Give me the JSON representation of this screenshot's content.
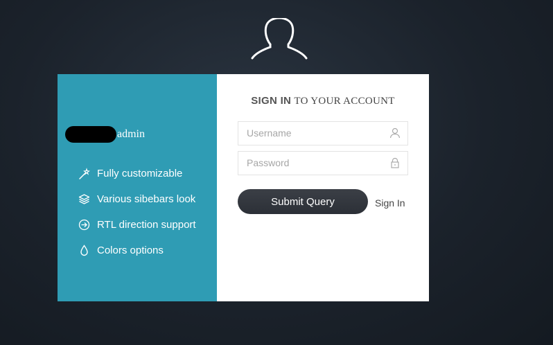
{
  "header": {
    "icon": "user-icon"
  },
  "brand": {
    "text": "admin"
  },
  "features": [
    {
      "icon": "magic-wand-icon",
      "label": "Fully customizable"
    },
    {
      "icon": "layers-icon",
      "label": "Various sibebars look"
    },
    {
      "icon": "circle-arrow-right-icon",
      "label": "RTL direction support"
    },
    {
      "icon": "drop-icon",
      "label": "Colors options"
    }
  ],
  "form": {
    "title_strong": "SIGN IN",
    "title_rest": "TO YOUR ACCOUNT",
    "username_placeholder": "Username",
    "password_placeholder": "Password",
    "submit_label": "Submit Query",
    "signin_link": "Sign In"
  },
  "colors": {
    "background": "#1b222b",
    "left_panel": "#2f9cb4",
    "button": "#33373e"
  }
}
